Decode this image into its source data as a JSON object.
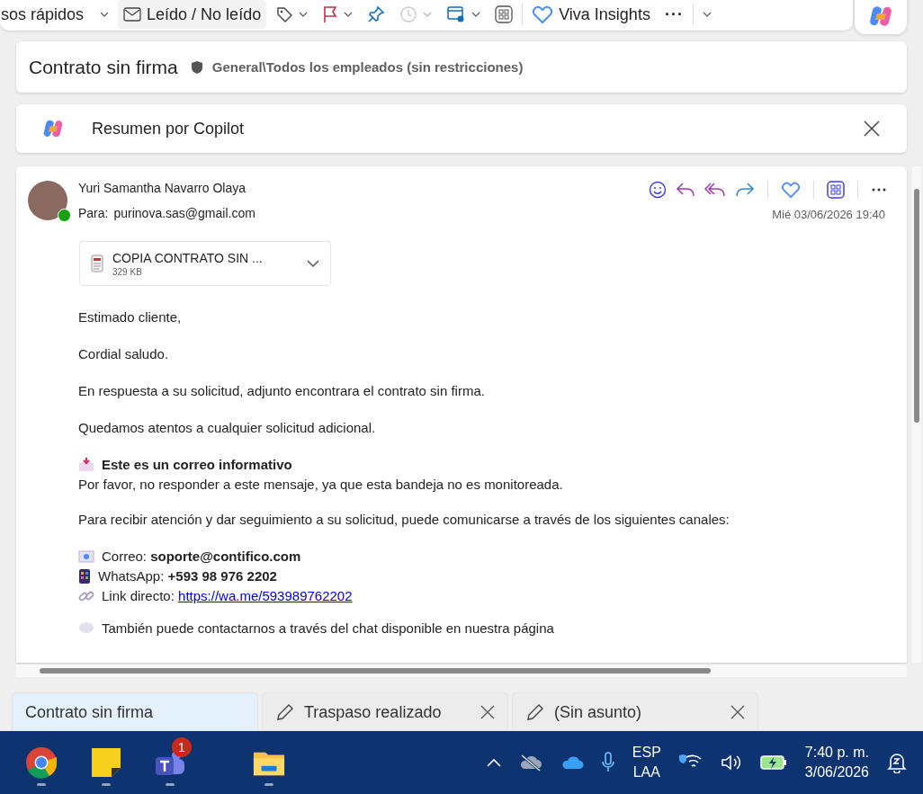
{
  "toolbar": {
    "items": [
      {
        "kind": "quick",
        "label": "sos rápidos",
        "dropdown": true,
        "disabled": false
      },
      {
        "kind": "read",
        "label": "Leído / No leído",
        "dropdown": false,
        "disabled": false
      },
      {
        "kind": "tag",
        "dropdown": true,
        "disabled": false
      },
      {
        "kind": "flag",
        "dropdown": true,
        "disabled": false
      },
      {
        "kind": "pin",
        "dropdown": false,
        "disabled": false
      },
      {
        "kind": "clock",
        "dropdown": true,
        "disabled": true
      },
      {
        "kind": "rules",
        "dropdown": true,
        "disabled": false
      },
      {
        "kind": "apps",
        "dropdown": false,
        "disabled": false
      },
      {
        "kind": "viva",
        "label": "Viva Insights",
        "dropdown": false,
        "disabled": false
      },
      {
        "kind": "more",
        "label": "···",
        "dropdown": false,
        "disabled": false
      },
      {
        "kind": "caret",
        "dropdown": true,
        "disabled": false
      }
    ]
  },
  "subject": {
    "title": "Contrato sin firma",
    "sensitivity": "General\\Todos los empleados (sin restricciones)"
  },
  "copilot": {
    "label": "Resumen por Copilot"
  },
  "message": {
    "sender": "Yuri Samantha Navarro Olaya",
    "online": true,
    "to_label": "Para:",
    "to": "purinova.sas@gmail.com",
    "date": "Mié 03/06/2026 19:40",
    "attachment": {
      "name": "COPIA CONTRATO SIN ...",
      "size": "329 KB"
    },
    "body": [
      {
        "kind": "text",
        "text": "Estimado cliente,"
      },
      {
        "kind": "text",
        "text": "Cordial saludo."
      },
      {
        "kind": "text",
        "text": "En respuesta a su solicitud, adjunto encontrara el contrato sin firma."
      },
      {
        "kind": "text",
        "text": "Quedamos atentos a cualquier solicitud adicional."
      },
      {
        "kind": "notice",
        "title": "Este es un correo informativo",
        "text": "Por favor, no responder a este mensaje, ya que esta bandeja no es monitoreada."
      },
      {
        "kind": "text",
        "text": "Para recibir atención y dar seguimiento a su solicitud, puede comunicarse a través de los siguientes canales:"
      },
      {
        "kind": "contacts",
        "items": [
          {
            "kind": "email",
            "text": "Correo: **soporte@contifico.com**"
          },
          {
            "kind": "phone",
            "text": "WhatsApp: **+593 98 976 2202**"
          },
          {
            "kind": "link",
            "text": "Link directo:",
            "link": "https://wa.me/593989762202"
          }
        ]
      },
      {
        "kind": "chat",
        "text": "También puede contactarnos a través del chat disponible en nuestra página"
      }
    ]
  },
  "tabs": [
    {
      "label": "Contrato sin firma",
      "selected": true,
      "draft": false
    },
    {
      "label": "Traspaso realizado",
      "selected": false,
      "draft": true
    },
    {
      "label": "(Sin asunto)",
      "selected": false,
      "draft": true
    }
  ],
  "taskbar": {
    "apps": [
      {
        "kind": "chrome"
      },
      {
        "kind": "notes"
      },
      {
        "kind": "teams",
        "badge": "1"
      },
      {
        "kind": "files"
      }
    ],
    "language": "ESP",
    "layout": "LAA",
    "time": "7:40 p. m.",
    "date": "3/06/2026"
  }
}
